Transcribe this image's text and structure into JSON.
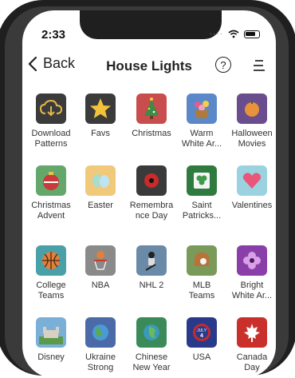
{
  "status": {
    "time": "2:33"
  },
  "nav": {
    "back_label": "Back",
    "title": "House Lights",
    "help_label": "?"
  },
  "tiles": [
    {
      "label": "Download\nPatterns",
      "icon": "cloud-download-icon",
      "color": "#3b3b3b"
    },
    {
      "label": "Favs",
      "icon": "star-icon",
      "color": "#3b3b3b"
    },
    {
      "label": "Christmas",
      "icon": "christmas-tree-icon",
      "color": "#c94d4d"
    },
    {
      "label": "Warm\nWhite Ar...",
      "icon": "flower-basket-icon",
      "color": "#5a88c9"
    },
    {
      "label": "Halloween\nMovies",
      "icon": "pumpkin-hand-icon",
      "color": "#6a4d8c"
    },
    {
      "label": "Christmas\nAdvent",
      "icon": "ornament-icon",
      "color": "#63a86a"
    },
    {
      "label": "Easter",
      "icon": "easter-eggs-icon",
      "color": "#f0c97a"
    },
    {
      "label": "Remembra\nnce Day",
      "icon": "poppy-icon",
      "color": "#3a3a3a"
    },
    {
      "label": "Saint\nPatricks...",
      "icon": "clover-icon",
      "color": "#2f7a3e"
    },
    {
      "label": "Valentines",
      "icon": "heart-icon",
      "color": "#9ad3df"
    },
    {
      "label": "College\nTeams",
      "icon": "basketball-icon",
      "color": "#4aa0a8"
    },
    {
      "label": "NBA",
      "icon": "basketball-hoop-icon",
      "color": "#8a8a8a"
    },
    {
      "label": "NHL 2",
      "icon": "hockey-player-icon",
      "color": "#6a8aa8"
    },
    {
      "label": "MLB\nTeams",
      "icon": "baseball-glove-icon",
      "color": "#7a9a5a"
    },
    {
      "label": "Bright\nWhite Ar...",
      "icon": "purple-flower-icon",
      "color": "#8a3fa8"
    },
    {
      "label": "Disney",
      "icon": "castle-icon",
      "color": "#7ab0d8"
    },
    {
      "label": "Ukraine\nStrong",
      "icon": "globe-icon",
      "color": "#4a6aa8"
    },
    {
      "label": "Chinese\nNew Year",
      "icon": "globe-asia-icon",
      "color": "#3a8a5a"
    },
    {
      "label": "USA",
      "icon": "july-4-badge-icon",
      "color": "#2a3a8a"
    },
    {
      "label": "Canada\nDay",
      "icon": "maple-leaf-icon",
      "color": "#c9302c"
    }
  ],
  "badge_text": {
    "july": "JULY",
    "four": "4"
  }
}
